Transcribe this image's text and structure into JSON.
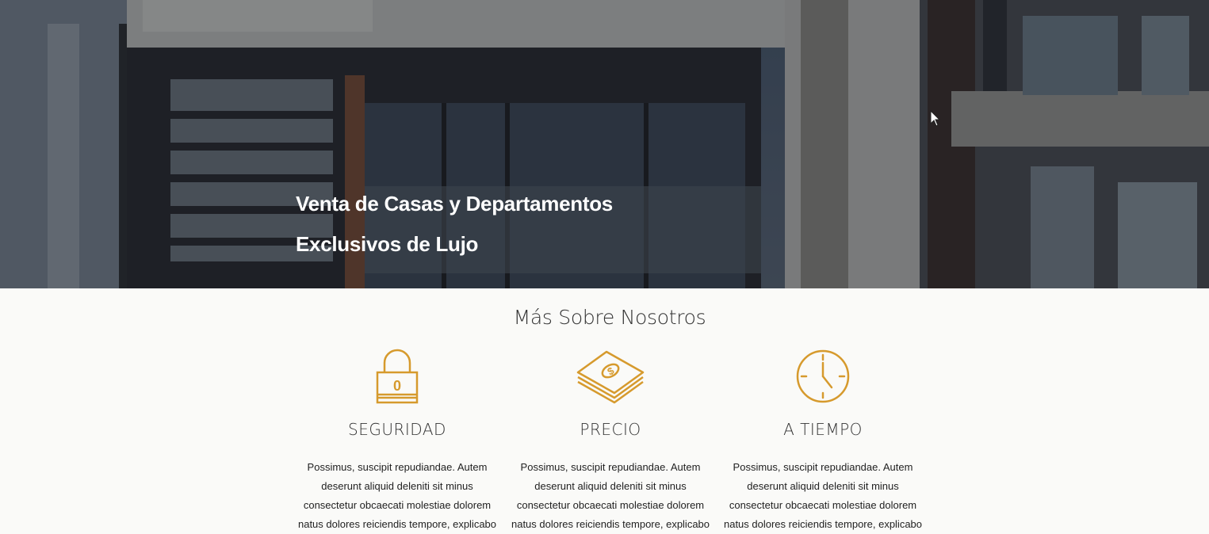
{
  "hero": {
    "title_line1": "Venta de Casas y Departamentos",
    "title_line2": "Exclusivos de Lujo",
    "image_name": "modern-house-photo"
  },
  "about": {
    "title": "Más Sobre Nosotros",
    "accent_color": "#d69a2d",
    "features": [
      {
        "icon": "padlock-icon",
        "title": "SEGURIDAD",
        "text": "Possimus, suscipit repudiandae. Autem deserunt aliquid deleniti sit minus consectetur obcaecati molestiae dolorem natus dolores reiciendis tempore, explicabo"
      },
      {
        "icon": "money-stack-icon",
        "title": "PRECIO",
        "text": "Possimus, suscipit repudiandae. Autem deserunt aliquid deleniti sit minus consectetur obcaecati molestiae dolorem natus dolores reiciendis tempore, explicabo"
      },
      {
        "icon": "clock-icon",
        "title": "A TIEMPO",
        "text": "Possimus, suscipit repudiandae. Autem deserunt aliquid deleniti sit minus consectetur obcaecati molestiae dolorem natus dolores reiciendis tempore, explicabo"
      }
    ]
  }
}
